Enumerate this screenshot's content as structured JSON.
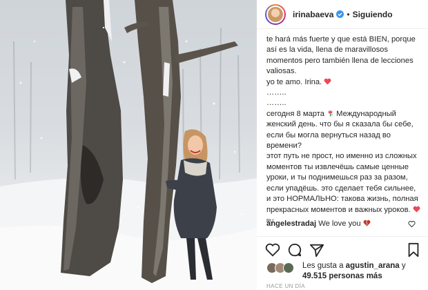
{
  "post": {
    "username": "irinabaeva",
    "separator": "•",
    "follow_status": "Siguiendo"
  },
  "caption": {
    "line1": "te hará más fuerte y que está BIEN, porque así es la vida, llena de maravillosos momentos pero también llena de lecciones valiosas.",
    "line2": "yo te amo. Irina.",
    "dots1": "……..",
    "dots2": "……..",
    "ru_intro": "сегодня 8 марта",
    "ru_body1": "Международный женский день. что бы я сказала бы себе, если бы могла вернуться назад во времени?",
    "ru_body2": "этот путь не прост, но именно из сложных моментов ты извлечёшь самые ценные уроки, и ты поднимешься раз за разом, если упадёшь. это сделает тебя сильнее, и это НОРМАЛЬНО: такова жизнь, полная прекрасных моментов и важных уроков.",
    "ru_tag": "RU"
  },
  "comment": {
    "user": "angelestradaj",
    "text": "We love you"
  },
  "likes": {
    "prefix": "Les gusta a",
    "user": "agustin_arana",
    "joiner": "y",
    "count": "49.515 personas más"
  },
  "timestamp": "HACE UN DÍA",
  "colors": {
    "heart_red": "#ed4956",
    "verified_blue": "#3897f0",
    "text": "#262626",
    "muted": "#999999"
  },
  "icons": {
    "like": "heart-outline-icon",
    "comment": "comment-bubble-icon",
    "share": "paper-plane-icon",
    "save": "bookmark-icon"
  }
}
